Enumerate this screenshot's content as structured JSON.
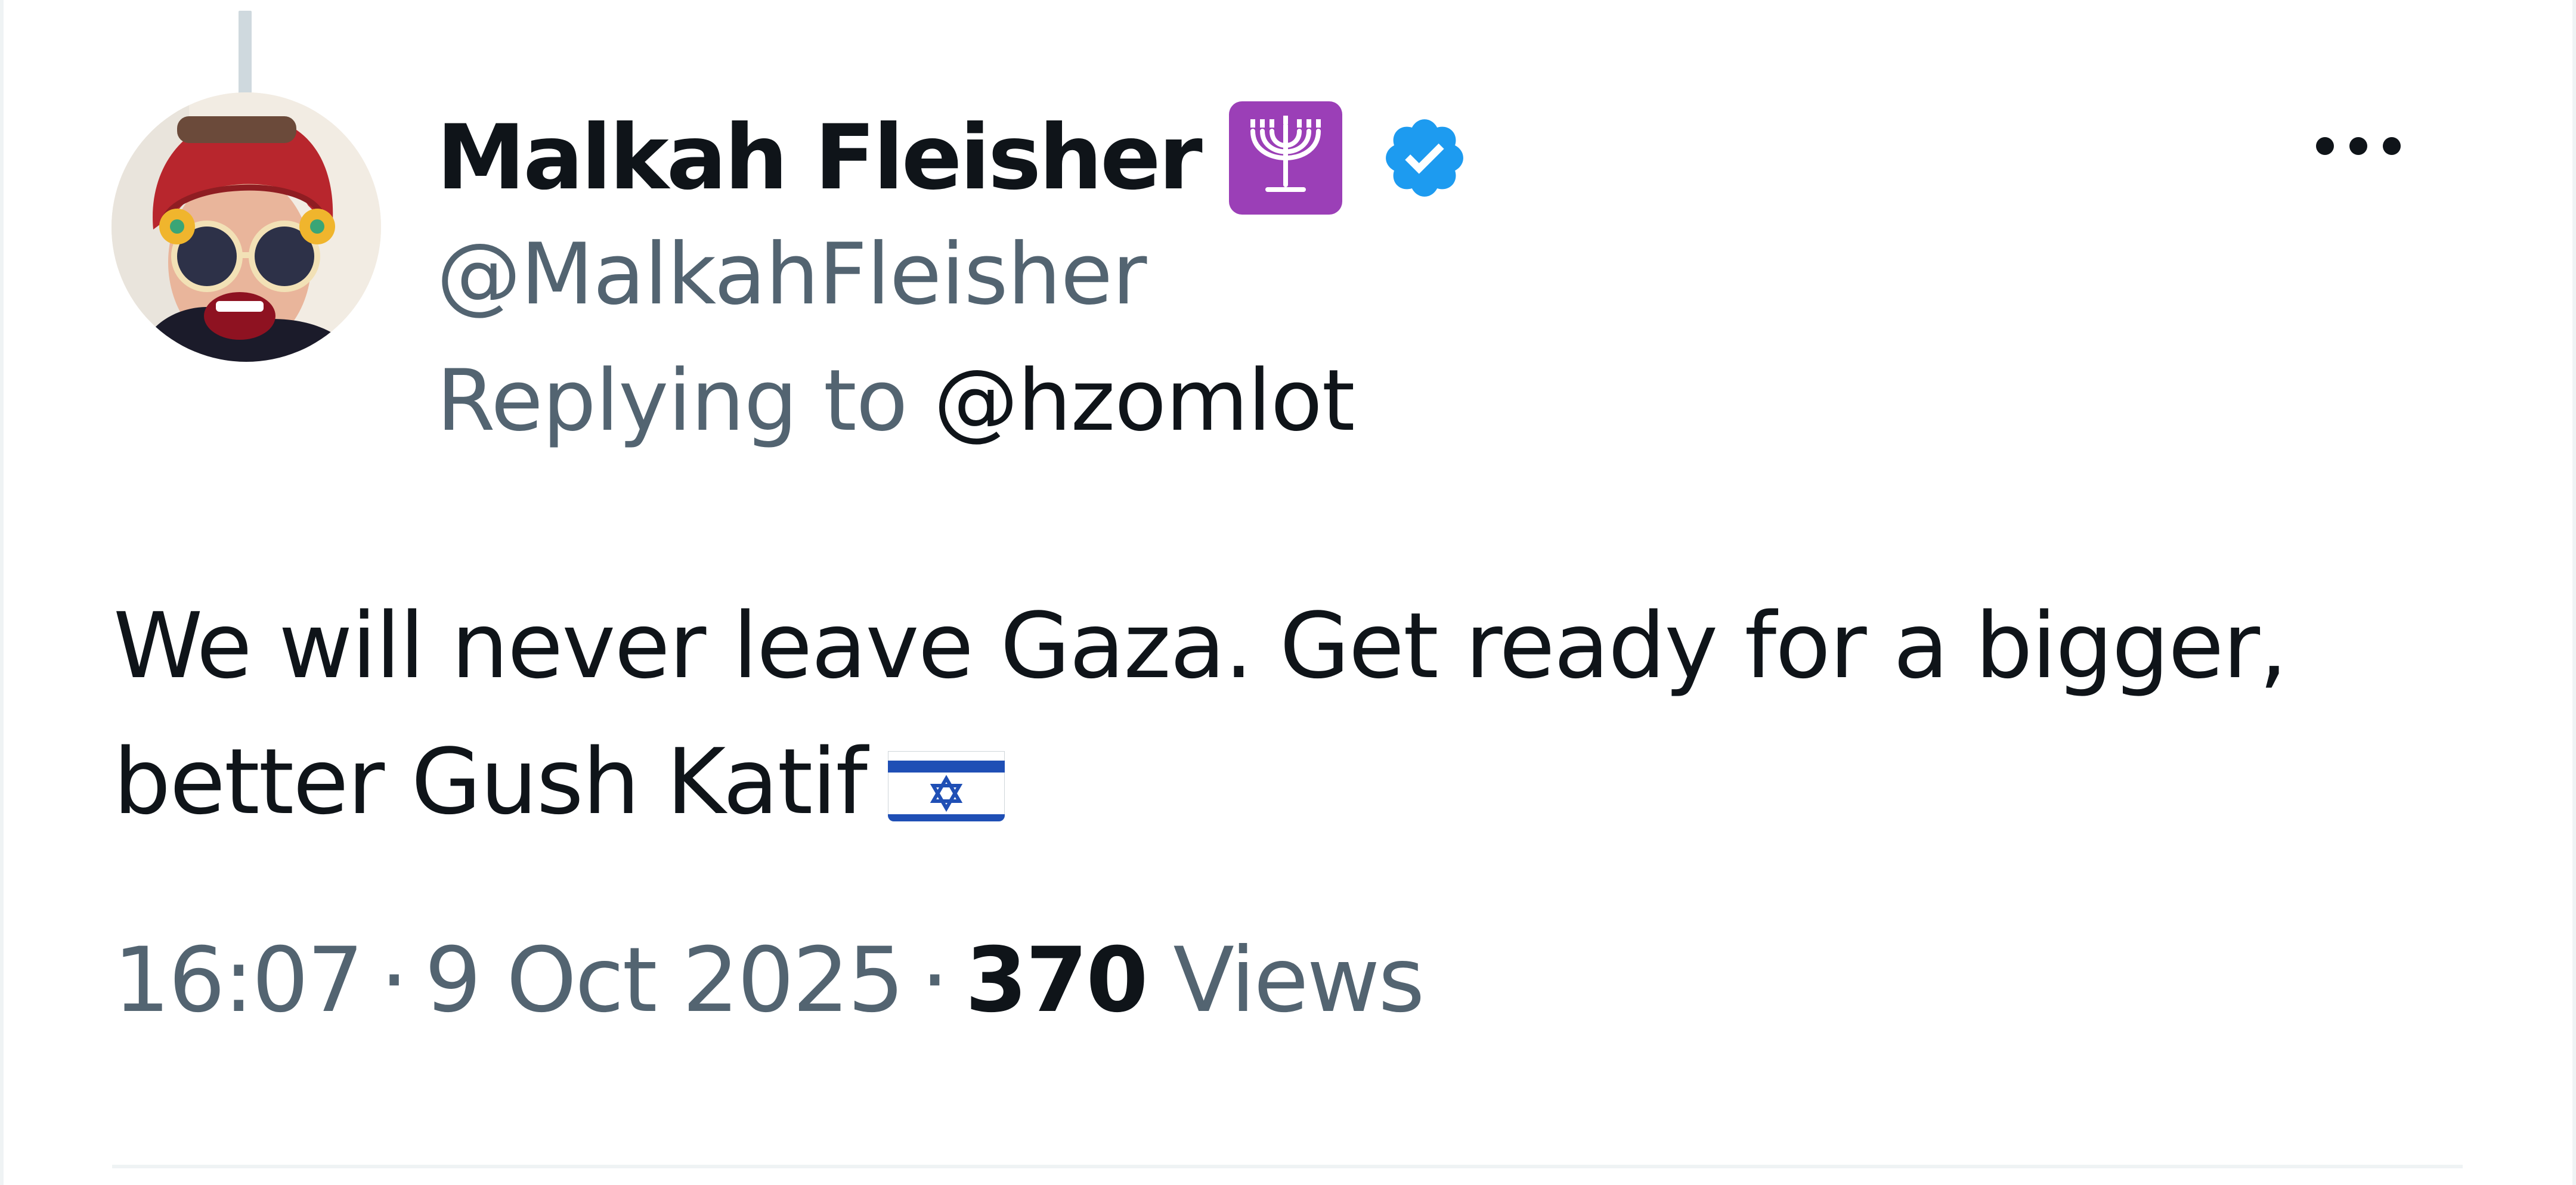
{
  "tweet": {
    "author": {
      "display_name": "Malkah Fleisher",
      "emoji": "🕎",
      "handle": "@MalkahFleisher",
      "verified": true,
      "avatar_icon": "profile-photo-avatar"
    },
    "reply": {
      "prefix": "Replying to",
      "target": "@hzomlot"
    },
    "text": "We will never leave Gaza. Get ready for a bigger, better Gush Katif",
    "text_emoji": "🇮🇱",
    "meta": {
      "time": "16:07",
      "separator": "·",
      "date": "9 Oct 2025",
      "views_count": "370",
      "views_label": "Views"
    },
    "more_icon": "more-options-icon"
  },
  "colors": {
    "text_primary": "#0f1419",
    "text_secondary": "#536471",
    "verified_blue": "#1d9bf0",
    "menorah_purple": "#9b3fb7",
    "divider": "#eff3f4"
  }
}
